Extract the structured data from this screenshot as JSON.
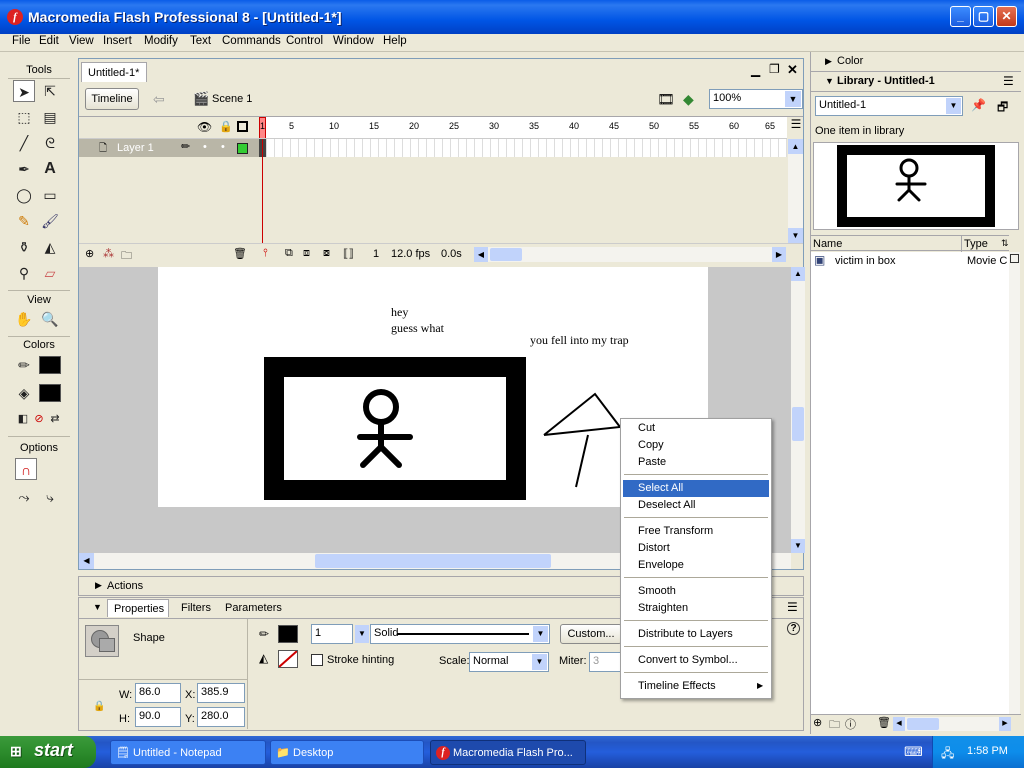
{
  "window": {
    "title": "Macromedia Flash Professional 8 - [Untitled-1*]"
  },
  "menu": [
    "File",
    "Edit",
    "View",
    "Insert",
    "Modify",
    "Text",
    "Commands",
    "Control",
    "Window",
    "Help"
  ],
  "tools": {
    "title": "Tools",
    "view_label": "View",
    "colors_label": "Colors",
    "options_label": "Options"
  },
  "document": {
    "tab": "Untitled-1*",
    "timeline_button": "Timeline",
    "scene": "Scene 1",
    "zoom": "100%",
    "layer_name": "Layer 1",
    "frame_numbers": [
      "1",
      "5",
      "10",
      "15",
      "20",
      "25",
      "30",
      "35",
      "40",
      "45",
      "50",
      "55",
      "60",
      "65"
    ],
    "current_frame": "1",
    "fps": "12.0 fps",
    "elapsed": "0.0s"
  },
  "stage": {
    "text_hey": "hey",
    "text_guess": "guess what",
    "text_trap": "you fell into my trap"
  },
  "context_menu": {
    "items": [
      "Cut",
      "Copy",
      "Paste",
      "Select All",
      "Deselect All",
      "Free Transform",
      "Distort",
      "Envelope",
      "Smooth",
      "Straighten",
      "Distribute to Layers",
      "Convert to Symbol...",
      "Timeline Effects"
    ],
    "highlighted": "Select All"
  },
  "actions_panel": {
    "title": "Actions"
  },
  "properties": {
    "tabs": [
      "Properties",
      "Filters",
      "Parameters"
    ],
    "object_type": "Shape",
    "stroke_height": "1",
    "stroke_style": "Solid",
    "custom_button": "Custom...",
    "stroke_hinting": "Stroke hinting",
    "scale_label": "Scale:",
    "scale_value": "Normal",
    "miter_label": "Miter:",
    "miter_value": "3",
    "w_label": "W:",
    "w": "86.0",
    "h_label": "H:",
    "h": "90.0",
    "x_label": "X:",
    "x": "385.9",
    "y_label": "Y:",
    "y": "280.0"
  },
  "right_panel": {
    "color_title": "Color",
    "library_title": "Library - Untitled-1",
    "library_select": "Untitled-1",
    "library_count": "One item in library",
    "col_name": "Name",
    "col_type": "Type",
    "item_name": "victim in box",
    "item_type": "Movie C"
  },
  "taskbar": {
    "start": "start",
    "tasks": [
      "Untitled - Notepad",
      "Desktop",
      "Macromedia Flash Pro..."
    ],
    "clock": "1:58 PM"
  }
}
